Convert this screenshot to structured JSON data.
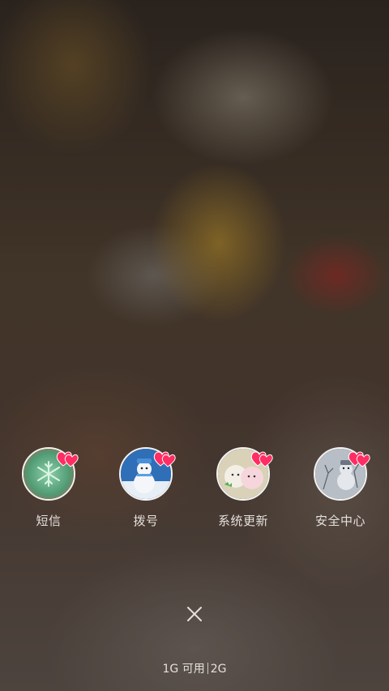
{
  "recent_apps": [
    {
      "label": "短信",
      "icon": "snowflake-thumbnail-icon",
      "badge_icon": "heart-badge-icon"
    },
    {
      "label": "拨号",
      "icon": "snowman-blue-thumbnail-icon",
      "badge_icon": "heart-badge-icon"
    },
    {
      "label": "系统更新",
      "icon": "snowmen-thumbnail-icon",
      "badge_icon": "heart-badge-icon"
    },
    {
      "label": "安全中心",
      "icon": "snowman-gray-thumbnail-icon",
      "badge_icon": "heart-badge-icon"
    }
  ],
  "close_icon": "close-icon",
  "memory": {
    "available": "1G 可用",
    "total": "2G"
  },
  "colors": {
    "heart": "#ff2d63",
    "text": "#e6e0dc",
    "icon_border": "#f2f2f2"
  }
}
